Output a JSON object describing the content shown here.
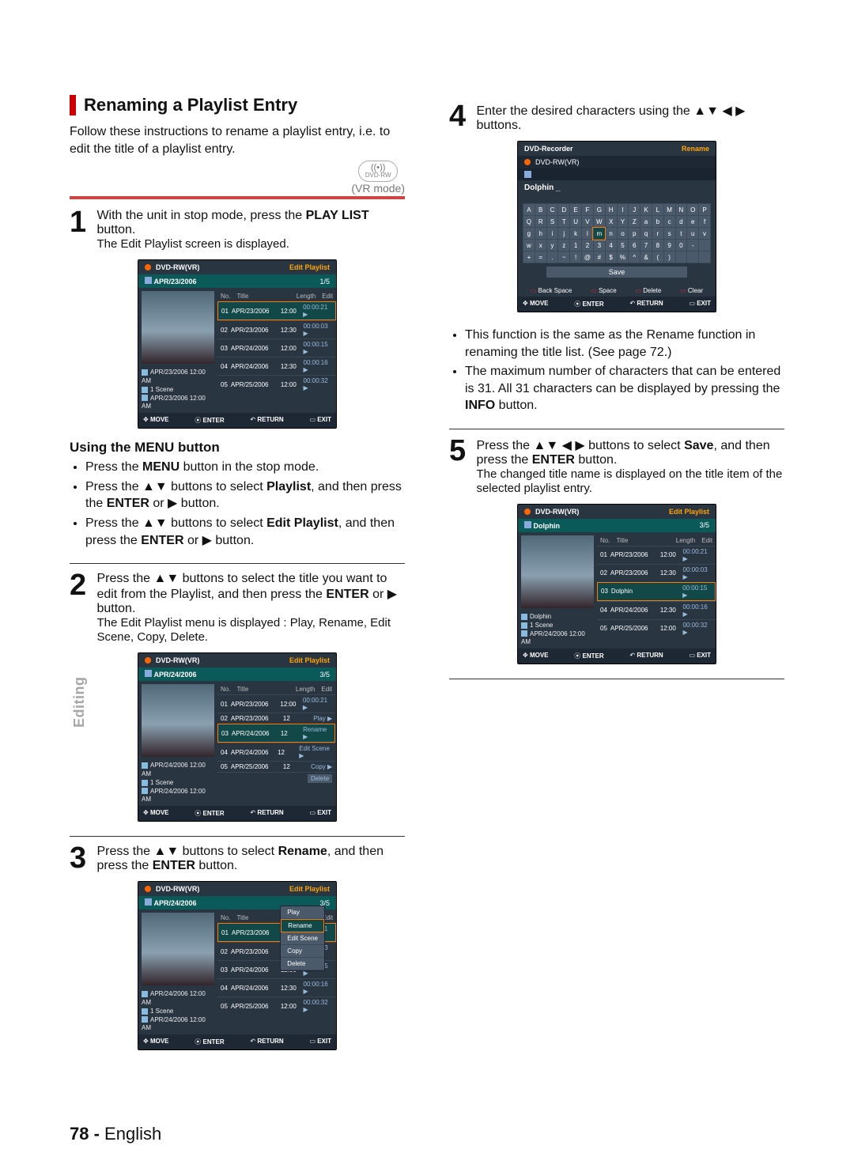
{
  "sidetab": "Editing",
  "page_footer": {
    "num": "78 -",
    "lang": "English"
  },
  "heading": "Renaming a Playlist Entry",
  "intro": "Follow these instructions to rename a playlist entry, i.e. to edit the title of a playlist entry.",
  "badge": {
    "top": "((•))",
    "label": "DVD-RW",
    "mode": "(VR mode)"
  },
  "step1": {
    "num": "1",
    "line1a": "With the unit in stop mode, press the ",
    "line1b": "PLAY LIST",
    "line1c": " button.",
    "line2": "The Edit Playlist screen is displayed."
  },
  "menu_sub": "Using the MENU button",
  "menu_b1a": "Press the ",
  "menu_b1b": "MENU",
  "menu_b1c": " button in the stop mode.",
  "menu_b2a": "Press the ▲▼ buttons to select ",
  "menu_b2b": "Playlist",
  "menu_b2c": ", and then press the ",
  "menu_b2d": "ENTER",
  "menu_b2e": " or ▶ button.",
  "menu_b3a": "Press the ▲▼ buttons to select ",
  "menu_b3b": "Edit Playlist",
  "menu_b3c": ", and then press the ",
  "menu_b3d": "ENTER",
  "menu_b3e": " or ▶ button.",
  "step2": {
    "num": "2",
    "l1": "Press the ▲▼ buttons to select the title you want to edit from the Playlist, and then press the ",
    "l1b": "ENTER",
    "l1c": " or ▶ button.",
    "l2": "The Edit Playlist menu is displayed : Play, Rename, Edit Scene, Copy, Delete."
  },
  "step3": {
    "num": "3",
    "l1": "Press the ▲▼ buttons to select ",
    "l1b": "Rename",
    "l1c": ", and then press the ",
    "l1d": "ENTER",
    "l1e": " button."
  },
  "step4": {
    "num": "4",
    "l1": "Enter the desired characters using the ▲▼ ◀ ▶ buttons."
  },
  "note1": "This function is the same as the Rename function in renaming the title list. (See page 72.)",
  "note2a": "The maximum number of characters that can be entered is 31. All 31 characters can be displayed by pressing the ",
  "note2b": "INFO",
  "note2c": " button.",
  "step5": {
    "num": "5",
    "l1": "Press the ▲▼ ◀ ▶ buttons to select ",
    "l1b": "Save",
    "l1c": ", and then press the ",
    "l1d": "ENTER",
    "l1e": " button.",
    "l2": "The changed title name is displayed on the title item of the selected playlist entry."
  },
  "osd_common": {
    "disc": "DVD-RW(VR)",
    "title_label": "Edit Playlist",
    "thead_no": "No.",
    "thead_title": "Title",
    "thead_len": "Length",
    "thead_edit": "Edit",
    "scene": "1 Scene",
    "foot_move": "MOVE",
    "foot_enter": "ENTER",
    "foot_return": "RETURN",
    "foot_exit": "EXIT"
  },
  "osd1": {
    "strip_title": "APR/23/2006",
    "count": "1/5",
    "info_date": "APR/23/2006 12:00 AM",
    "info_time": "APR/23/2006 12:00 AM",
    "rows": [
      {
        "n": "01",
        "t": "APR/23/2006",
        "d": "12:00",
        "l": "00:00:21",
        "sel": true
      },
      {
        "n": "02",
        "t": "APR/23/2006",
        "d": "12:30",
        "l": "00:00:03"
      },
      {
        "n": "03",
        "t": "APR/24/2006",
        "d": "12:00",
        "l": "00:00:15"
      },
      {
        "n": "04",
        "t": "APR/24/2006",
        "d": "12:30",
        "l": "00:00:16"
      },
      {
        "n": "05",
        "t": "APR/25/2006",
        "d": "12:00",
        "l": "00:00:32"
      }
    ]
  },
  "osd2": {
    "strip_title": "APR/24/2006",
    "count": "3/5",
    "info_date": "APR/24/2006 12:00 AM",
    "info_time": "APR/24/2006 12:00 AM",
    "rows": [
      {
        "n": "01",
        "t": "APR/23/2006",
        "d": "12:00",
        "l": "00:00:21"
      },
      {
        "n": "02",
        "t": "APR/23/2006",
        "d": "12",
        "menu": "Play"
      },
      {
        "n": "03",
        "t": "APR/24/2006",
        "d": "12",
        "menu": "Rename",
        "sel": true
      },
      {
        "n": "04",
        "t": "APR/24/2006",
        "d": "12",
        "menu": "Edit Scene"
      },
      {
        "n": "05",
        "t": "APR/25/2006",
        "d": "12",
        "menu": "Copy"
      }
    ],
    "extra_menu": "Delete"
  },
  "osd3_menu": [
    "Play",
    "Rename",
    "Edit Scene",
    "Copy",
    "Delete"
  ],
  "osd3_hi": "Rename",
  "osd_ren": {
    "header": "DVD-Recorder",
    "right": "Rename",
    "disc": "DVD-RW(VR)",
    "input": "Dolphin _",
    "row1": [
      "A",
      "B",
      "C",
      "D",
      "E",
      "F",
      "G",
      "H",
      "I",
      "J",
      "K",
      "L",
      "M",
      "N",
      "O",
      "P"
    ],
    "row2": [
      "Q",
      "R",
      "S",
      "T",
      "U",
      "V",
      "W",
      "X",
      "Y",
      "Z",
      "a",
      "b",
      "c",
      "d",
      "e",
      "f"
    ],
    "row3": [
      "g",
      "h",
      "i",
      "j",
      "k",
      "l",
      "m",
      "n",
      "o",
      "p",
      "q",
      "r",
      "s",
      "t",
      "u",
      "v"
    ],
    "row4": [
      "w",
      "x",
      "y",
      "z",
      "1",
      "2",
      "3",
      "4",
      "5",
      "6",
      "7",
      "8",
      "9",
      "0",
      "-",
      " "
    ],
    "row5": [
      "+",
      "=",
      ".",
      "~",
      "!",
      "@",
      "#",
      "$",
      "%",
      "^",
      "&",
      "(",
      ")",
      "",
      "",
      ""
    ],
    "sel": "m",
    "save": "Save",
    "btns": [
      "Back Space",
      "Space",
      "Delete",
      "Clear"
    ]
  },
  "osd5": {
    "strip_title": "Dolphin",
    "count": "3/5",
    "info_date": "Dolphin",
    "info_time": "APR/24/2006 12:00 AM",
    "rows": [
      {
        "n": "01",
        "t": "APR/23/2006",
        "d": "12:00",
        "l": "00:00:21"
      },
      {
        "n": "02",
        "t": "APR/23/2006",
        "d": "12:30",
        "l": "00:00:03"
      },
      {
        "n": "03",
        "t": "Dolphin",
        "d": "",
        "l": "00:00:15",
        "sel": true
      },
      {
        "n": "04",
        "t": "APR/24/2006",
        "d": "12:30",
        "l": "00:00:16"
      },
      {
        "n": "05",
        "t": "APR/25/2006",
        "d": "12:00",
        "l": "00:00:32"
      }
    ]
  }
}
